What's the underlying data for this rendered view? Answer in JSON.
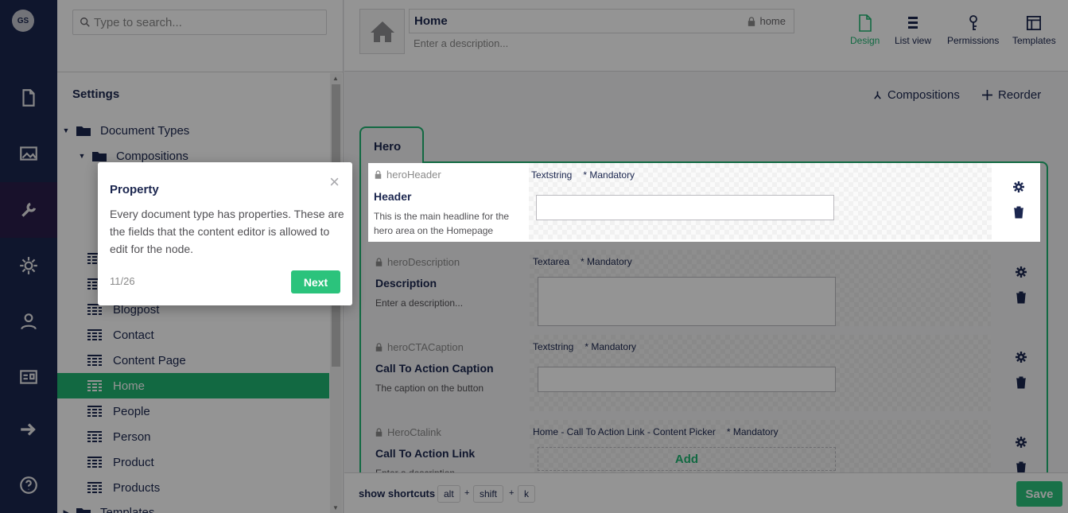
{
  "user": {
    "initials": "GS"
  },
  "rail": {
    "sections": [
      {
        "name": "content",
        "icon": "document-icon"
      },
      {
        "name": "media",
        "icon": "image-icon"
      },
      {
        "name": "settings",
        "icon": "wrench-icon",
        "active": true
      },
      {
        "name": "packages",
        "icon": "gear-icon"
      },
      {
        "name": "users",
        "icon": "user-icon"
      },
      {
        "name": "members",
        "icon": "id-card-icon"
      },
      {
        "name": "forms",
        "icon": "arrow-right-icon"
      },
      {
        "name": "help",
        "icon": "help-icon"
      }
    ]
  },
  "tree": {
    "search_placeholder": "Type to search...",
    "title": "Settings",
    "items": [
      {
        "label": "Document Types",
        "type": "folder",
        "level": 0,
        "expanded": true
      },
      {
        "label": "Compositions",
        "type": "folder",
        "level": 1,
        "expanded": true
      },
      {
        "label": "Blogpost",
        "type": "doctype",
        "level": 2
      },
      {
        "label": "Contact",
        "type": "doctype",
        "level": 2
      },
      {
        "label": "Content Page",
        "type": "doctype",
        "level": 2
      },
      {
        "label": "Home",
        "type": "doctype",
        "level": 2,
        "selected": true
      },
      {
        "label": "People",
        "type": "doctype",
        "level": 2
      },
      {
        "label": "Person",
        "type": "doctype",
        "level": 2
      },
      {
        "label": "Product",
        "type": "doctype",
        "level": 2
      },
      {
        "label": "Products",
        "type": "doctype",
        "level": 2
      },
      {
        "label": "Templates",
        "type": "folder",
        "level": 0
      }
    ]
  },
  "editor": {
    "name": "Home",
    "alias": "home",
    "description_placeholder": "Enter a description...",
    "apps": [
      {
        "label": "Design",
        "icon": "document-outline-icon",
        "active": true
      },
      {
        "label": "List view",
        "icon": "list-icon"
      },
      {
        "label": "Permissions",
        "icon": "key-icon"
      },
      {
        "label": "Templates",
        "icon": "layout-icon"
      }
    ],
    "actions": {
      "compositions": "Compositions",
      "reorder": "Reorder"
    },
    "tab_label": "Hero",
    "properties": [
      {
        "alias": "heroHeader",
        "label": "Header",
        "description": "This is the main headline for the hero area on the Homepage",
        "editor": "Textstring",
        "mandatory": "* Mandatory"
      },
      {
        "alias": "heroDescription",
        "label": "Description",
        "description": "Enter a description...",
        "editor": "Textarea",
        "mandatory": "* Mandatory"
      },
      {
        "alias": "heroCTACaption",
        "label": "Call To Action Caption",
        "description": "The caption on the button",
        "editor": "Textstring",
        "mandatory": "* Mandatory"
      },
      {
        "alias": "HeroCtalink",
        "label": "Call To Action Link",
        "description": "Enter a description...",
        "editor": "Home - Call To Action Link - Content Picker",
        "mandatory": "* Mandatory",
        "add_label": "Add"
      }
    ]
  },
  "footer": {
    "shortcuts_label": "show shortcuts",
    "keys": [
      "alt",
      "shift",
      "k"
    ],
    "save_label": "Save"
  },
  "tour": {
    "title": "Property",
    "body": "Every document type has properties. These are the fields that the content editor is allowed to edit for the node.",
    "step": "11/26",
    "next_label": "Next"
  },
  "colors": {
    "accent": "#2bc37c",
    "selected": "#1fb572",
    "rail": "#1b264f"
  }
}
